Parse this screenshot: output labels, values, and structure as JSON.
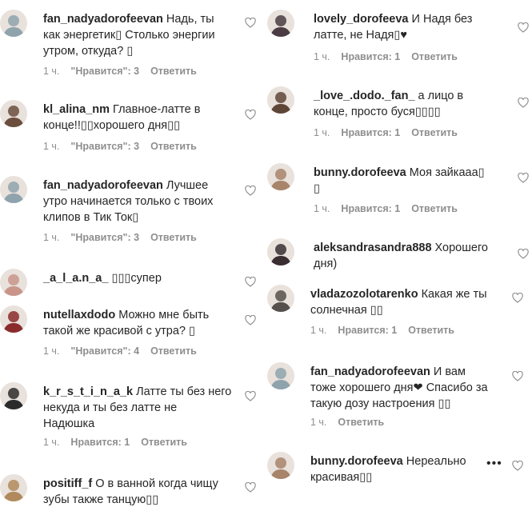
{
  "left": [
    {
      "user": "fan_nadyadorofeevan",
      "text": "Надь, ты\nкак энергетик▯ Столько энергии\nутром, откуда? ▯",
      "time": "1 ч.",
      "likes": "\"Нравится\": 3",
      "reply": "Ответить",
      "avatar": "#8fa3ad"
    },
    {
      "user": "kl_alina_nm",
      "text": "Главное-латте в\nконце!!▯▯хорошего дня▯▯",
      "time": "1 ч.",
      "likes": "\"Нравится\": 3",
      "reply": "Ответить",
      "avatar": "#6b4e3d"
    },
    {
      "user": "fan_nadyadorofeevan",
      "text": "Лучшее\nутро начинается только с твоих\nклипов в Тик Ток▯",
      "time": "1 ч.",
      "likes": "\"Нравится\": 3",
      "reply": "Ответить",
      "avatar": "#8fa3ad"
    },
    {
      "user": "_a_l_a.n_a_",
      "text": "▯▯▯супер",
      "time": "",
      "likes": "",
      "reply": "",
      "avatar": "#c9958a"
    },
    {
      "user": "nutellaxdodo",
      "text": "Можно мне быть\nтакой же красивой с утра? ▯",
      "time": "1 ч.",
      "likes": "\"Нравится\": 4",
      "reply": "Ответить",
      "avatar": "#8a2c2c"
    },
    {
      "user": "k_r_s_t_i_n_a_k",
      "text": "Латте ты без него\nнекуда и ты без латте не\nНадюшка",
      "time": "1 ч.",
      "likes": "Нравится: 1",
      "reply": "Ответить",
      "avatar": "#2b2b2b"
    },
    {
      "user": "positiff_f",
      "text": "О в ванной когда чищу\nзубы также танцую▯▯",
      "time": "",
      "likes": "",
      "reply": "",
      "avatar": "#b08a5c"
    }
  ],
  "right": [
    {
      "user": "lovely_dorofeeva",
      "text": "И Надя без\nлатте, не Надя▯♥",
      "time": "1 ч.",
      "likes": "Нравится: 1",
      "reply": "Ответить",
      "avatar": "#4a3c42"
    },
    {
      "user": "_love_.dodo._fan_",
      "text": "а лицо в\nконце, просто буся▯▯▯▯",
      "time": "1 ч.",
      "likes": "Нравится: 1",
      "reply": "Ответить",
      "avatar": "#5e4636"
    },
    {
      "user": "bunny.dorofeeva",
      "text": "Моя зайкааа▯\n▯",
      "time": "1 ч.",
      "likes": "Нравится: 1",
      "reply": "Ответить",
      "avatar": "#a8846a"
    },
    {
      "user": "aleksandrasandra888",
      "text": "Хорошего\nдня)",
      "time": "",
      "likes": "",
      "reply": "",
      "avatar": "#3a2e33"
    },
    {
      "user": "vladazozolotarenko",
      "text": "Какая же ты\nсолнечная ▯▯",
      "time": "1 ч.",
      "likes": "Нравится: 1",
      "reply": "Ответить",
      "avatar": "#55504c"
    },
    {
      "user": "fan_nadyadorofeevan",
      "text": "И вам\nтоже хорошего дня❤ Спасибо за\nтакую дозу настроения ▯▯",
      "time": "1 ч.",
      "likes": "",
      "reply": "Ответить",
      "avatar": "#8fa3ad"
    },
    {
      "user": "bunny.dorofeeva",
      "text": "Нереально\nкрасивая▯▯",
      "time": "",
      "likes": "",
      "reply": "",
      "avatar": "#a8846a"
    }
  ],
  "more_options_label": "•••"
}
